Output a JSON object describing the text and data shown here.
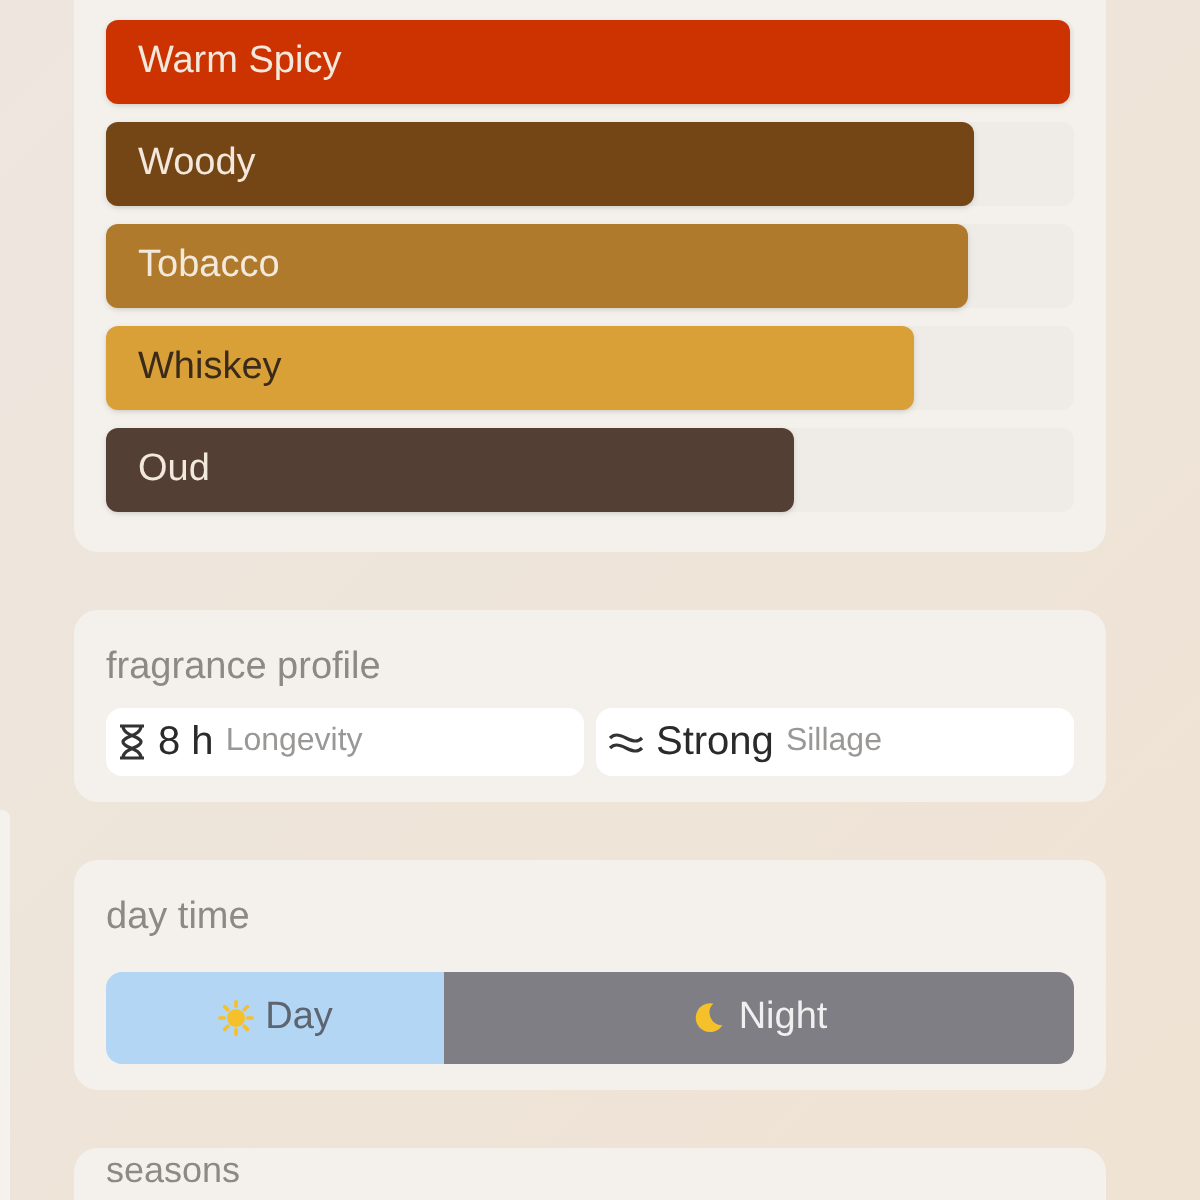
{
  "accords": [
    {
      "name": "Warm Spicy",
      "color": "#cc3300",
      "level": 1.0
    },
    {
      "name": "Woody",
      "color": "#744515",
      "level": 0.9
    },
    {
      "name": "Tobacco",
      "color": "#b07a2c",
      "level": 0.894
    },
    {
      "name": "Whiskey",
      "color": "#d9a038",
      "level": 0.838
    },
    {
      "name": "Oud",
      "color": "#533f33",
      "level": 0.713
    }
  ],
  "fragrance_profile": {
    "title": "fragrance profile",
    "stats": [
      {
        "kind": "longevity",
        "value": "8 h",
        "label": "Longevity"
      },
      {
        "kind": "sillage",
        "value": "Strong",
        "label": "Sillage"
      }
    ]
  },
  "day_time": {
    "title": "day time",
    "options": [
      {
        "kind": "day",
        "label": "Day",
        "selected": true
      },
      {
        "kind": "night",
        "label": "Night",
        "selected": false
      }
    ]
  },
  "seasons": {
    "title": "seasons"
  }
}
